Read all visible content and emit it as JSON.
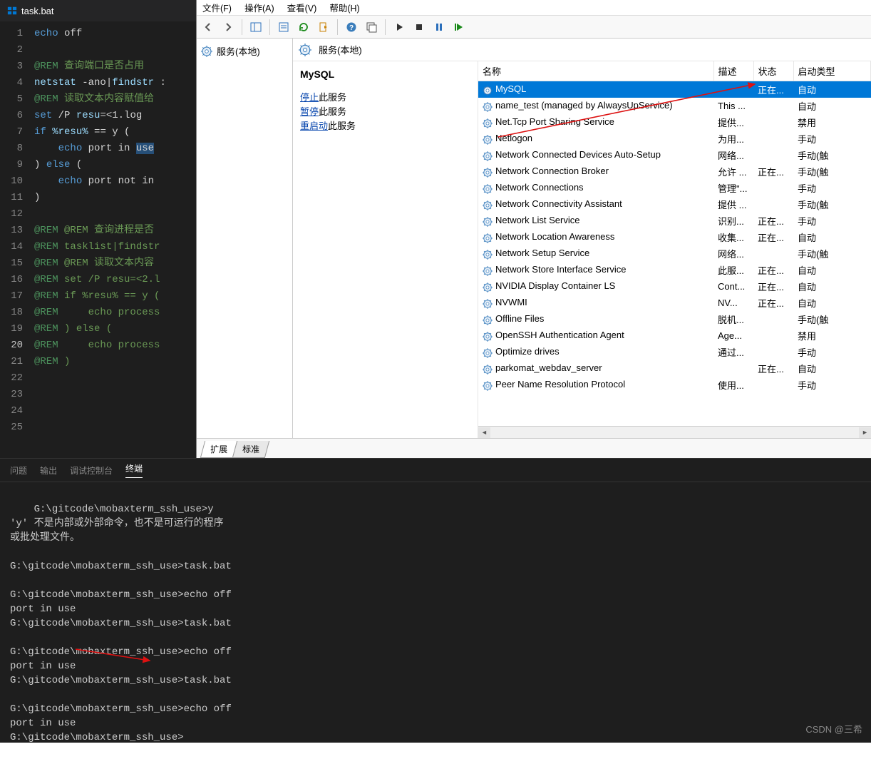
{
  "editor": {
    "filename": "task.bat",
    "lines": [
      {
        "n": 1,
        "seg": [
          [
            "kw",
            "echo"
          ],
          [
            "plain",
            " off"
          ]
        ]
      },
      {
        "n": 2,
        "seg": []
      },
      {
        "n": 3,
        "seg": [
          [
            "rem",
            "@REM"
          ],
          [
            "cmt",
            " 查询端口是否占用"
          ]
        ]
      },
      {
        "n": 4,
        "seg": [
          [
            "id",
            "netstat"
          ],
          [
            "plain",
            " -ano|"
          ],
          [
            "id",
            "findstr"
          ],
          [
            "plain",
            " :"
          ]
        ]
      },
      {
        "n": 5,
        "seg": [
          [
            "rem",
            "@REM"
          ],
          [
            "cmt",
            " 读取文本内容赋值给"
          ]
        ]
      },
      {
        "n": 6,
        "seg": [
          [
            "kw",
            "set"
          ],
          [
            "plain",
            " /P "
          ],
          [
            "id",
            "resu"
          ],
          [
            "plain",
            "=<1.log"
          ]
        ]
      },
      {
        "n": 7,
        "seg": [
          [
            "kw",
            "if"
          ],
          [
            "plain",
            " "
          ],
          [
            "id",
            "%resu%"
          ],
          [
            "plain",
            " == y ("
          ]
        ]
      },
      {
        "n": 8,
        "seg": [
          [
            "plain",
            "    "
          ],
          [
            "kw",
            "echo"
          ],
          [
            "plain",
            " port in "
          ],
          [
            "hl",
            "use"
          ]
        ]
      },
      {
        "n": 9,
        "seg": [
          [
            "plain",
            ") "
          ],
          [
            "kw",
            "else"
          ],
          [
            "plain",
            " ("
          ]
        ]
      },
      {
        "n": 10,
        "seg": [
          [
            "plain",
            "    "
          ],
          [
            "kw",
            "echo"
          ],
          [
            "plain",
            " port not in "
          ]
        ]
      },
      {
        "n": 11,
        "seg": [
          [
            "plain",
            ")"
          ]
        ]
      },
      {
        "n": 12,
        "seg": []
      },
      {
        "n": 13,
        "seg": [
          [
            "rem",
            "@REM"
          ],
          [
            "cmt",
            " @REM 查询进程是否"
          ]
        ]
      },
      {
        "n": 14,
        "seg": [
          [
            "rem",
            "@REM"
          ],
          [
            "cmt",
            " tasklist|findstr"
          ]
        ]
      },
      {
        "n": 15,
        "seg": [
          [
            "rem",
            "@REM"
          ],
          [
            "cmt",
            " @REM 读取文本内容"
          ]
        ]
      },
      {
        "n": 16,
        "seg": [
          [
            "rem",
            "@REM"
          ],
          [
            "cmt",
            " set /P resu=<2.l"
          ]
        ]
      },
      {
        "n": 17,
        "seg": [
          [
            "rem",
            "@REM"
          ],
          [
            "cmt",
            " if %resu% == y ("
          ]
        ]
      },
      {
        "n": 18,
        "seg": [
          [
            "rem",
            "@REM"
          ],
          [
            "cmt",
            "     echo process"
          ]
        ]
      },
      {
        "n": 19,
        "seg": [
          [
            "rem",
            "@REM"
          ],
          [
            "cmt",
            " ) else ("
          ]
        ]
      },
      {
        "n": 20,
        "seg": [
          [
            "rem",
            "@REM"
          ],
          [
            "cmt",
            "     echo process"
          ]
        ]
      },
      {
        "n": 21,
        "seg": [
          [
            "rem",
            "@REM"
          ],
          [
            "cmt",
            " )"
          ]
        ]
      },
      {
        "n": 22,
        "seg": []
      },
      {
        "n": 23,
        "seg": []
      },
      {
        "n": 24,
        "seg": []
      },
      {
        "n": 25,
        "seg": []
      }
    ],
    "current_line": 20
  },
  "terminal_tabs": {
    "problems": "问题",
    "output": "输出",
    "debug": "调试控制台",
    "terminal": "终端"
  },
  "terminal_text": "G:\\gitcode\\mobaxterm_ssh_use>y\n'y' 不是内部或外部命令，也不是可运行的程序\n或批处理文件。\n\nG:\\gitcode\\mobaxterm_ssh_use>task.bat\n\nG:\\gitcode\\mobaxterm_ssh_use>echo off\nport in use\nG:\\gitcode\\mobaxterm_ssh_use>task.bat\n\nG:\\gitcode\\mobaxterm_ssh_use>echo off\nport in use\nG:\\gitcode\\mobaxterm_ssh_use>task.bat\n\nG:\\gitcode\\mobaxterm_ssh_use>echo off\nport in use\nG:\\gitcode\\mobaxterm_ssh_use>",
  "watermark": "CSDN @三希",
  "services": {
    "menu": {
      "file": "文件(F)",
      "action": "操作(A)",
      "view": "查看(V)",
      "help": "帮助(H)"
    },
    "left_header": "服务(本地)",
    "right_header": "服务(本地)",
    "info_title": "MySQL",
    "info_links": {
      "stop": "停止",
      "stop_suffix": "此服务",
      "pause": "暂停",
      "pause_suffix": "此服务",
      "restart": "重启动",
      "restart_suffix": "此服务"
    },
    "columns": {
      "name": "名称",
      "desc": "描述",
      "status": "状态",
      "startup": "启动类型"
    },
    "rows": [
      {
        "name": "MySQL",
        "desc": "",
        "status": "正在...",
        "startup": "自动",
        "selected": true
      },
      {
        "name": "name_test (managed by AlwaysUpService)",
        "desc": "This ...",
        "status": "",
        "startup": "自动"
      },
      {
        "name": "Net.Tcp Port Sharing Service",
        "desc": "提供...",
        "status": "",
        "startup": "禁用"
      },
      {
        "name": "Netlogon",
        "desc": "为用...",
        "status": "",
        "startup": "手动"
      },
      {
        "name": "Network Connected Devices Auto-Setup",
        "desc": "网络...",
        "status": "",
        "startup": "手动(触"
      },
      {
        "name": "Network Connection Broker",
        "desc": "允许 ...",
        "status": "正在...",
        "startup": "手动(触"
      },
      {
        "name": "Network Connections",
        "desc": "管理\"...",
        "status": "",
        "startup": "手动"
      },
      {
        "name": "Network Connectivity Assistant",
        "desc": "提供 ...",
        "status": "",
        "startup": "手动(触"
      },
      {
        "name": "Network List Service",
        "desc": "识别...",
        "status": "正在...",
        "startup": "手动"
      },
      {
        "name": "Network Location Awareness",
        "desc": "收集...",
        "status": "正在...",
        "startup": "自动"
      },
      {
        "name": "Network Setup Service",
        "desc": "网络...",
        "status": "",
        "startup": "手动(触"
      },
      {
        "name": "Network Store Interface Service",
        "desc": "此服...",
        "status": "正在...",
        "startup": "自动"
      },
      {
        "name": "NVIDIA Display Container LS",
        "desc": "Cont...",
        "status": "正在...",
        "startup": "自动"
      },
      {
        "name": "NVWMI",
        "desc": "NV...",
        "status": "正在...",
        "startup": "自动"
      },
      {
        "name": "Offline Files",
        "desc": "脱机...",
        "status": "",
        "startup": "手动(触"
      },
      {
        "name": "OpenSSH Authentication Agent",
        "desc": "Age...",
        "status": "",
        "startup": "禁用"
      },
      {
        "name": "Optimize drives",
        "desc": "通过...",
        "status": "",
        "startup": "手动"
      },
      {
        "name": "parkomat_webdav_server",
        "desc": "",
        "status": "正在...",
        "startup": "自动"
      },
      {
        "name": "Peer Name Resolution Protocol",
        "desc": "使用...",
        "status": "",
        "startup": "手动"
      }
    ],
    "tabs": {
      "extended": "扩展",
      "standard": "标准"
    }
  }
}
